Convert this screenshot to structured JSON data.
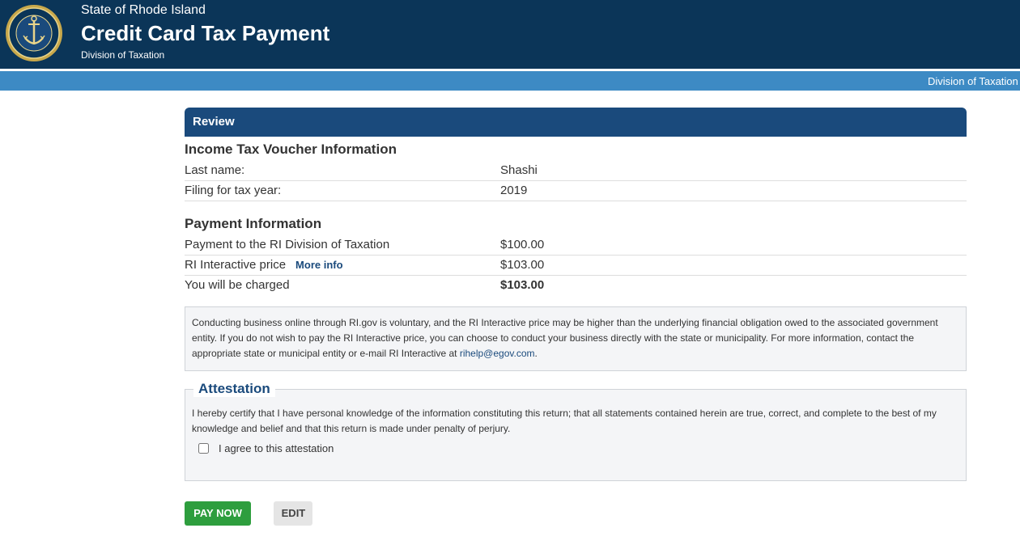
{
  "header": {
    "state_name": "State of Rhode Island",
    "app_title": "Credit Card Tax Payment",
    "division": "Division of Taxation",
    "subnav_link": "Division of Taxation",
    "colors": {
      "primary": "#0b3558",
      "subnav": "#3d8ac4"
    },
    "seal_icon": "rhode-island-seal-icon"
  },
  "review": {
    "panel_title": "Review",
    "voucher_section_title": "Income Tax Voucher Information",
    "voucher_rows": [
      {
        "label": "Last name:",
        "value": "Shashi"
      },
      {
        "label": "Filing for tax year:",
        "value": "2019"
      }
    ],
    "payment_section_title": "Payment Information",
    "payment_rows": [
      {
        "label": "Payment to the RI Division of Taxation",
        "value": "$100.00"
      },
      {
        "label": "RI Interactive price",
        "link": "More info",
        "value": "$103.00"
      },
      {
        "label": "You will be charged",
        "value": "$103.00"
      }
    ],
    "notice": {
      "text": "Conducting business online through RI.gov is voluntary, and the RI Interactive price may be higher than the underlying financial obligation owed to the associated government entity. If you do not wish to pay the RI Interactive price, you can choose to conduct your business directly with the state or municipality. For more information, contact the appropriate state or municipal entity or e-mail RI Interactive at ",
      "email": "rihelp@egov.com",
      "end": "."
    }
  },
  "attestation": {
    "legend": "Attestation",
    "text": "I hereby certify that I have personal knowledge of the information constituting this return; that all statements contained herein are true, correct, and complete to the best of my knowledge and belief and that this return is made under penalty of perjury.",
    "checkbox_label": "I agree to this attestation"
  },
  "actions": {
    "pay_now": "PAY NOW",
    "edit": "EDIT",
    "colors": {
      "pay": "#2e9e3e",
      "edit": "#e5e5e5"
    }
  }
}
